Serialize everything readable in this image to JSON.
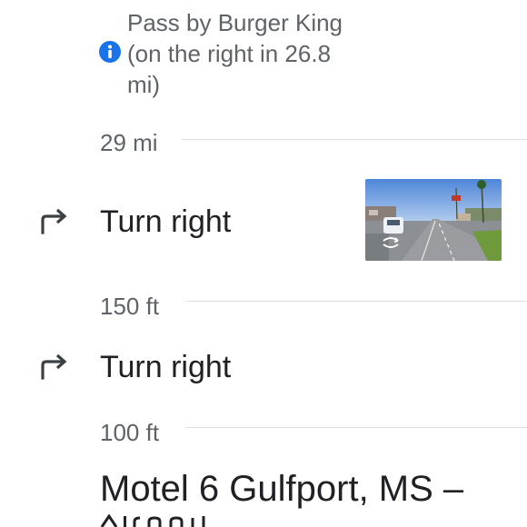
{
  "note": {
    "line1": "Pass by Burger King",
    "line2": "(on the right in 26.8",
    "line3": "mi)",
    "icon": "info-icon"
  },
  "segments": [
    {
      "distance": "29 mi"
    },
    {
      "distance": "150 ft"
    },
    {
      "distance": "100 ft"
    }
  ],
  "steps": [
    {
      "instruction": "Turn right",
      "icon": "turn-right-icon",
      "has_thumbnail": true
    },
    {
      "instruction": "Turn right",
      "icon": "turn-right-icon",
      "has_thumbnail": false
    }
  ],
  "destination": {
    "name": "Motel 6 Gulfport, MS –"
  },
  "colors": {
    "info_blue": "#1a73e8",
    "text_primary": "#202124",
    "text_secondary": "#5f6368",
    "divider": "#dadce0"
  }
}
